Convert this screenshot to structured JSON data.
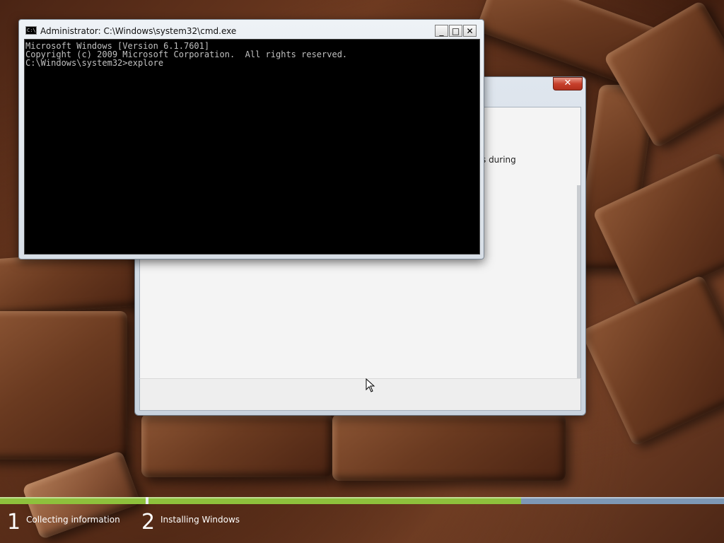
{
  "cmd_window": {
    "title": "Administrator: C:\\Windows\\system32\\cmd.exe",
    "icon_text": "C:\\.",
    "minimize_glyph": "_",
    "maximize_glyph": "□",
    "close_glyph": "✕",
    "lines": [
      "Microsoft Windows [Version 6.1.7601]",
      "Copyright (c) 2009 Microsoft Corporation.  All rights reserved.",
      "",
      "C:\\Windows\\system32>explore"
    ]
  },
  "setup_dialog": {
    "close_glyph": "✕",
    "visible_text": "s during"
  },
  "progress": {
    "collecting_fraction": 1.0,
    "installing_fraction": 0.647
  },
  "steps": [
    {
      "number": "1",
      "label": "Collecting information"
    },
    {
      "number": "2",
      "label": "Installing Windows"
    }
  ],
  "colors": {
    "progress_fill": "#8ec13c",
    "progress_track": "#7e98b5",
    "console_background": "#000000",
    "console_text": "#c0c0c0"
  }
}
